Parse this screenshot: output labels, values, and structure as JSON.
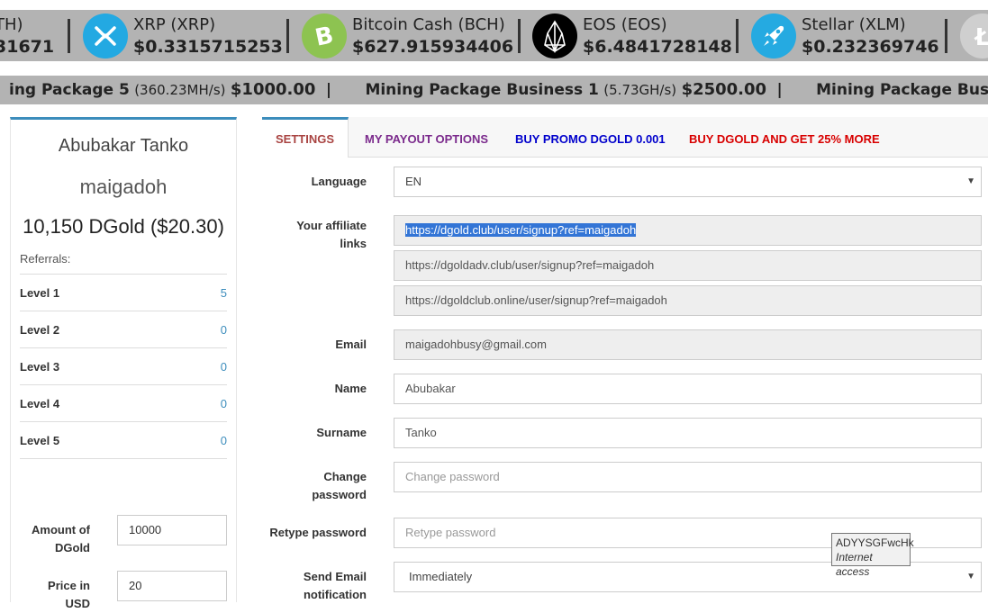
{
  "ticker": {
    "partial_first": {
      "name": "TH)",
      "price": "31671"
    },
    "coins": [
      {
        "name": "XRP (XRP)",
        "price": "$0.3315715253",
        "icon": "xrp-icon",
        "color": "#23a9e2"
      },
      {
        "name": "Bitcoin Cash (BCH)",
        "price": "$627.915934406",
        "icon": "bitcoin-cash-icon",
        "color": "#8dc351"
      },
      {
        "name": "EOS (EOS)",
        "price": "$6.4841728148",
        "icon": "eos-icon",
        "color": "#000000"
      },
      {
        "name": "Stellar (XLM)",
        "price": "$0.232369746",
        "icon": "stellar-icon",
        "color": "#25aae1"
      }
    ],
    "partial_last_icon": "litecoin-icon"
  },
  "packages": [
    {
      "name": "ing Package 5",
      "rate": "(360.23MH/s)",
      "price": "$1000.00"
    },
    {
      "name": "Mining Package Business 1",
      "rate": "(5.73GH/s)",
      "price": "$2500.00"
    },
    {
      "name": "Mining Package Business",
      "rate": "",
      "price": ""
    }
  ],
  "profile": {
    "full_name": "Abubakar Tanko",
    "username": "maigadoh",
    "balance": "10,150 DGold ($20.30)",
    "referrals_label": "Referrals:",
    "levels": [
      {
        "label": "Level 1",
        "count": "5"
      },
      {
        "label": "Level 2",
        "count": "0"
      },
      {
        "label": "Level 3",
        "count": "0"
      },
      {
        "label": "Level 4",
        "count": "0"
      },
      {
        "label": "Level 5",
        "count": "0"
      }
    ],
    "amount_label_1": "Amount of",
    "amount_label_2": "DGold",
    "amount_value": "10000",
    "price_label": "Price in USD",
    "price_value": "20"
  },
  "tabs": [
    {
      "label": "SETTINGS",
      "color": "#a94442"
    },
    {
      "label": "MY PAYOUT OPTIONS",
      "color": "#7b2a8c"
    },
    {
      "label": "BUY PROMO DGOLD 0.001",
      "color": "#0000cc"
    },
    {
      "label": "BUY DGOLD AND GET 25% MORE",
      "color": "#d80000"
    }
  ],
  "form": {
    "language_label": "Language",
    "language_value": "EN",
    "affiliate_label_1": "Your affiliate",
    "affiliate_label_2": "links",
    "affiliate_links": [
      "https://dgold.club/user/signup?ref=maigadoh",
      "https://dgoldadv.club/user/signup?ref=maigadoh",
      "https://dgoldclub.online/user/signup?ref=maigadoh"
    ],
    "email_label": "Email",
    "email_value": "maigadohbusy@gmail.com",
    "name_label": "Name",
    "name_value": "Abubakar",
    "surname_label": "Surname",
    "surname_value": "Tanko",
    "change_password_label_1": "Change",
    "change_password_label_2": "password",
    "change_password_placeholder": "Change password",
    "retype_password_label": "Retype password",
    "retype_password_placeholder": "Retype password",
    "send_email_label_1": "Send Email",
    "send_email_label_2": "notification",
    "send_email_value": "Immediately"
  },
  "tooltip": {
    "line1": "ADYYSGFwcHk",
    "line2": "Internet access"
  }
}
